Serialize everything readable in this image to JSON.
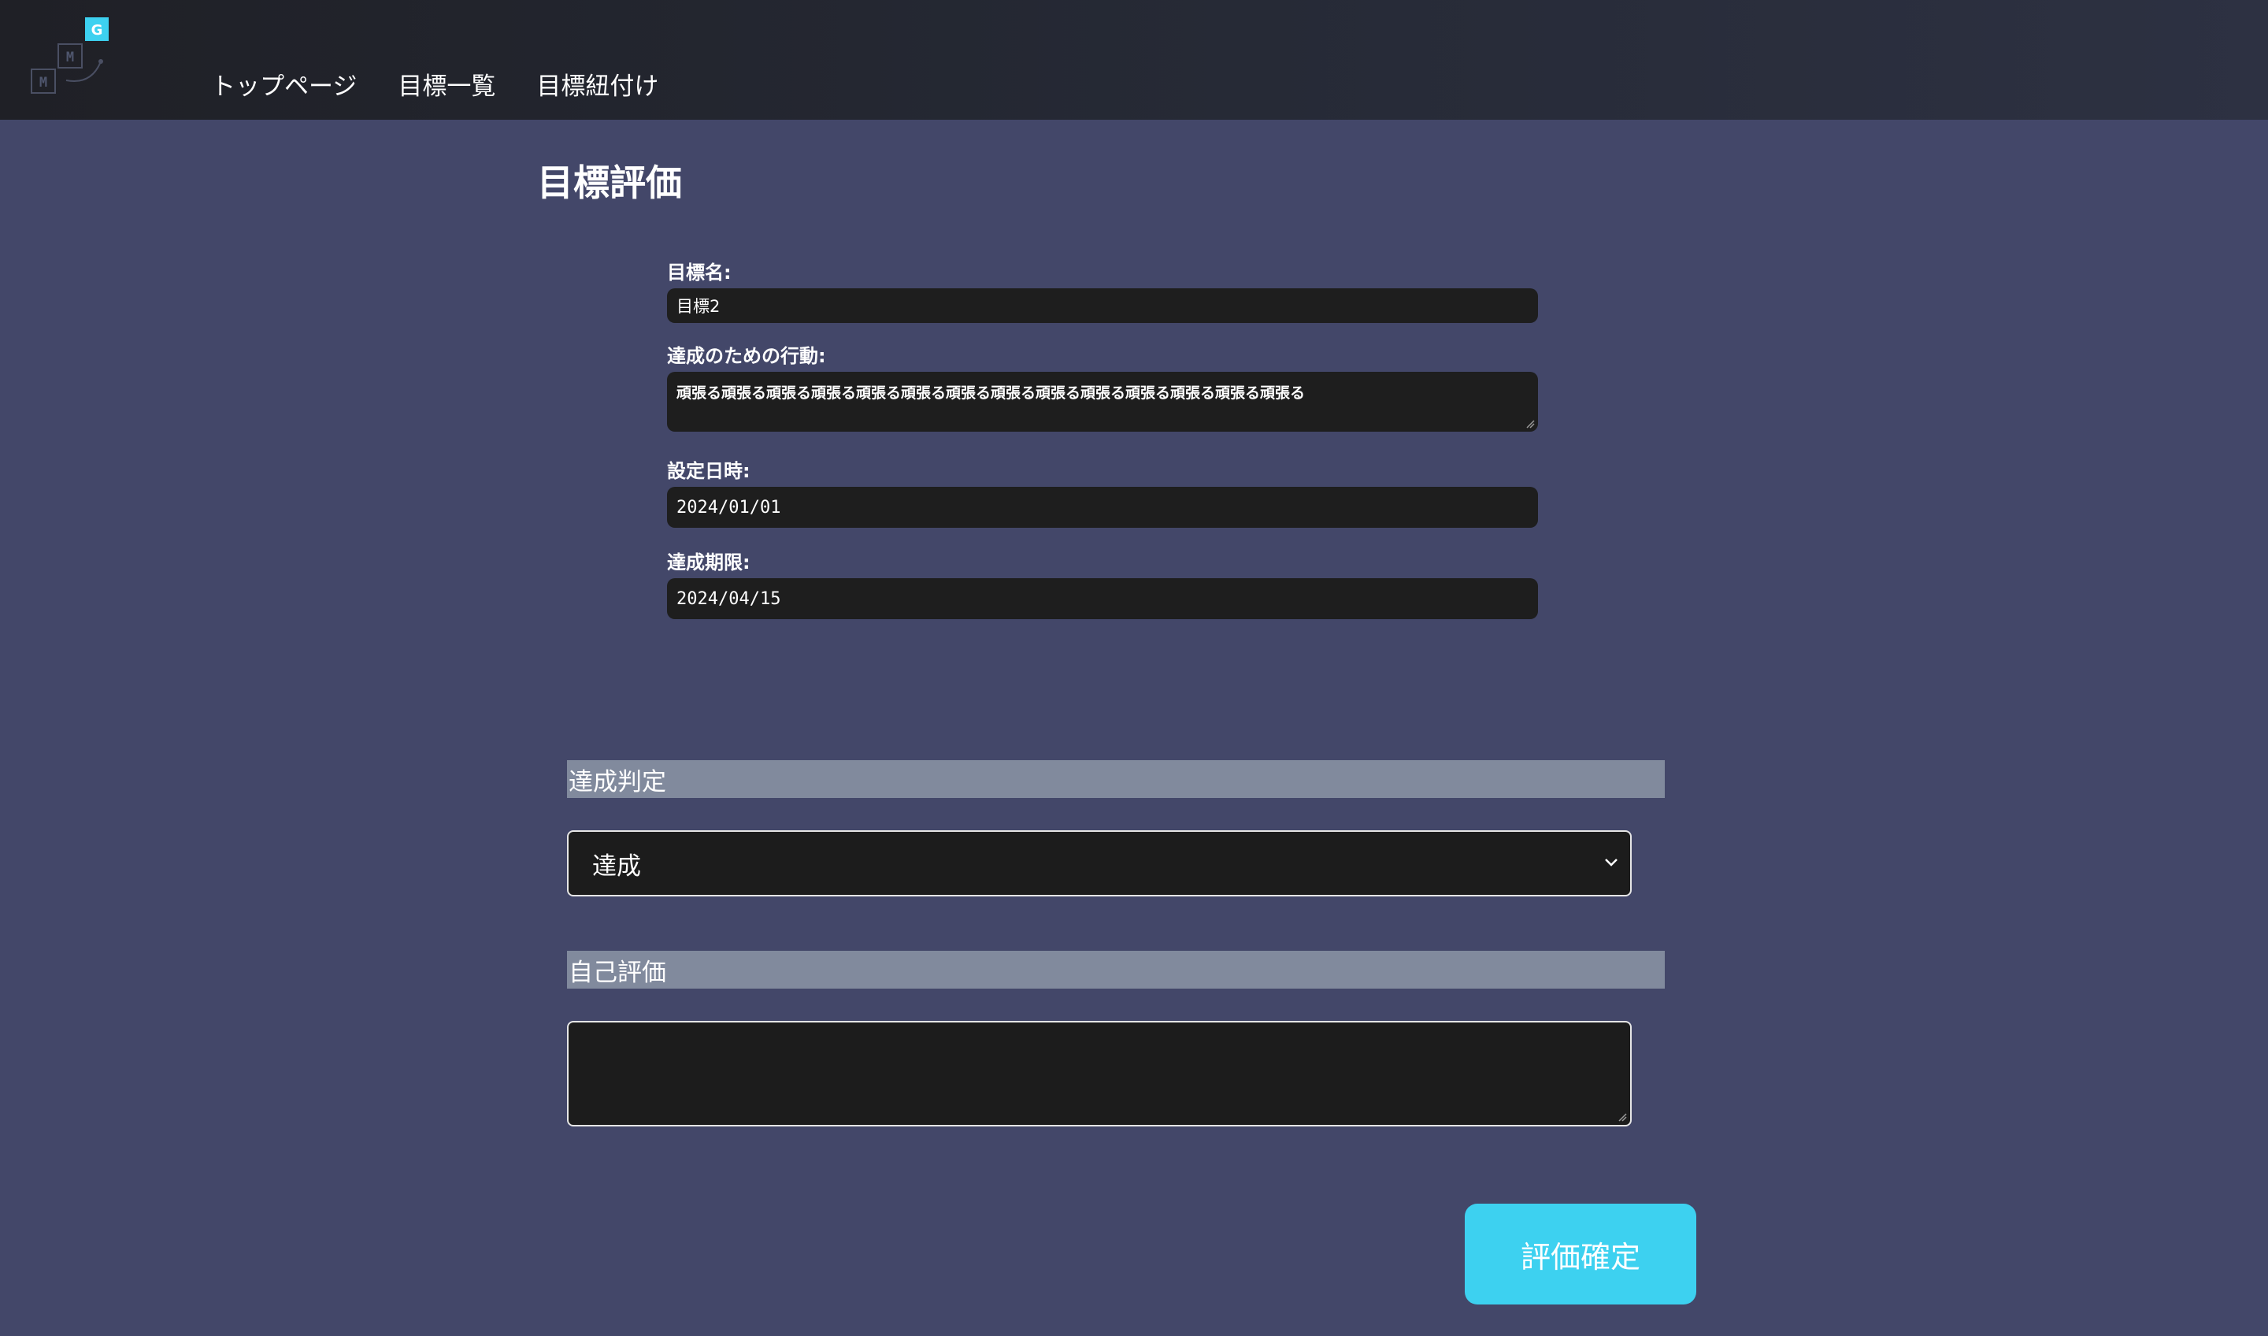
{
  "header": {
    "logo": {
      "letters": [
        "G",
        "M",
        "M"
      ],
      "accent_color": "#3dd1f0"
    },
    "nav": [
      {
        "label": "トップページ"
      },
      {
        "label": "目標一覧"
      },
      {
        "label": "目標紐付け"
      }
    ]
  },
  "page": {
    "title": "目標評価"
  },
  "goal": {
    "name_label": "目標名:",
    "name_value": "目標2",
    "action_label": "達成のための行動:",
    "action_value": "頑張る頑張る頑張る頑張る頑張る頑張る頑張る頑張る頑張る頑張る頑張る頑張る頑張る頑張る",
    "set_date_label": "設定日時:",
    "set_date_value": "2024/01/01",
    "deadline_label": "達成期限:",
    "deadline_value": "2024/04/15"
  },
  "judgement": {
    "header": "達成判定",
    "selected": "達成"
  },
  "self_eval": {
    "header": "自己評価",
    "value": ""
  },
  "actions": {
    "submit_label": "評価確定"
  },
  "colors": {
    "background": "#434769",
    "header_bg": "#23252e",
    "field_bg": "#1e1e1e",
    "section_header_bg": "#818a9d",
    "button": "#3dd1f0"
  }
}
